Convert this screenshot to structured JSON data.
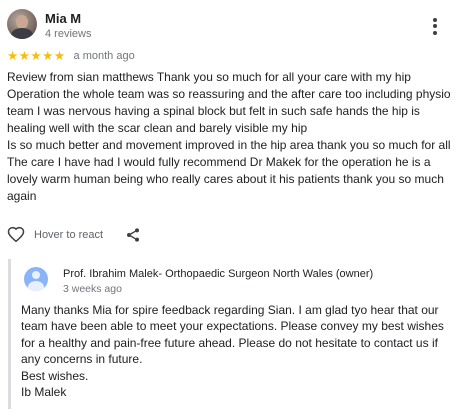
{
  "review": {
    "reviewer": {
      "name": "Mia M",
      "meta": "4 reviews"
    },
    "rating": {
      "value": 5,
      "max": 5,
      "stars_display": "★★★★★",
      "color": "#fbbc04"
    },
    "date": "a month ago",
    "text": "Review from sian matthews Thank you so much for all your care with my hip\nOperation the whole team was so reassuring and the after care too including physio\nteam I was nervous having a spinal block but felt in such safe hands the hip is\nhealing well with the scar clean and barely visible my hip\nIs so much better and movement improved in the hip area thank you so much for all\nThe care I have had I would fully recommend Dr Makek for the operation he is a\nlovely warm human being who really cares about it his patients thank you so much\nagain",
    "actions": {
      "react_label": "Hover to react",
      "react_icon": "heart-outline-icon",
      "share_icon": "share-icon"
    },
    "more_icon": "more-vert-icon"
  },
  "owner_reply": {
    "name": "Prof. Ibrahim Malek- Orthopaedic Surgeon North Wales (owner)",
    "date": "3 weeks ago",
    "avatar_icon": "person-avatar-icon",
    "text": "Many thanks Mia for spire feedback regarding Sian. I am glad tyo hear that our\nteam have been able to meet your expectations. Please convey my best wishes\nfor a healthy and pain-free future ahead. Please do not hesitate to contact us if\nany concerns in future.\nBest wishes.\nIb Malek"
  }
}
